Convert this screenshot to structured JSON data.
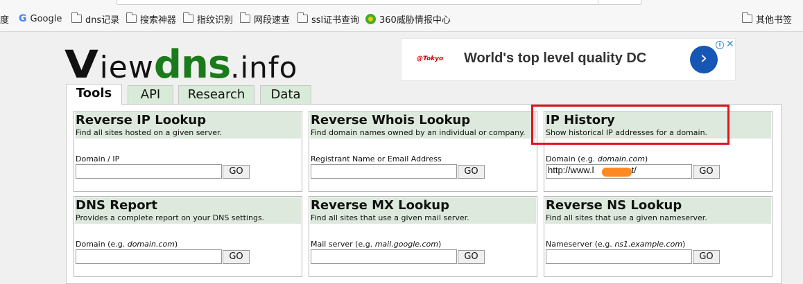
{
  "bookmarks": [
    {
      "label": "度",
      "icon": "none"
    },
    {
      "label": "Google",
      "icon": "google-icon"
    },
    {
      "label": "dns记录",
      "icon": "folder-icon"
    },
    {
      "label": "搜索神器",
      "icon": "folder-icon"
    },
    {
      "label": "指纹识别",
      "icon": "folder-icon"
    },
    {
      "label": "网段速查",
      "icon": "folder-icon"
    },
    {
      "label": "ssl证书查询",
      "icon": "folder-icon"
    },
    {
      "label": "360威胁情报中心",
      "icon": "360-icon"
    },
    {
      "label": "其他书签",
      "icon": "folder-icon"
    }
  ],
  "logo": {
    "v": "V",
    "iew": "iew",
    "dns": "dns",
    "info": ".info"
  },
  "ad": {
    "brand": "@Tokyo",
    "text": "World's top level quality DC",
    "arrow": "›",
    "info": "i",
    "close": "✕"
  },
  "tabs": [
    "Tools",
    "API",
    "Research",
    "Data"
  ],
  "tools": [
    {
      "title": "Reverse IP Lookup",
      "desc": "Find all sites hosted on a given server.",
      "label": "Domain / IP",
      "label_example": "",
      "label_suffix": "",
      "value": "",
      "go": "GO"
    },
    {
      "title": "Reverse Whois Lookup",
      "desc": "Find domain names owned by an individual or company.",
      "label": "Registrant Name or Email Address",
      "label_example": "",
      "label_suffix": "",
      "value": "",
      "go": "GO"
    },
    {
      "title": "IP History",
      "desc": "Show historical IP addresses for a domain.",
      "label": "Domain (e.g. ",
      "label_example": "domain.com",
      "label_suffix": ")",
      "value": "http://www.l        o.net/",
      "go": "GO"
    },
    {
      "title": "DNS Report",
      "desc": "Provides a complete report on your DNS settings.",
      "label": "Domain (e.g. ",
      "label_example": "domain.com",
      "label_suffix": ")",
      "value": "",
      "go": "GO"
    },
    {
      "title": "Reverse MX Lookup",
      "desc": "Find all sites that use a given mail server.",
      "label": "Mail server (e.g. ",
      "label_example": "mail.google.com",
      "label_suffix": ")",
      "value": "",
      "go": "GO"
    },
    {
      "title": "Reverse NS Lookup",
      "desc": "Find all sites that use a given nameserver.",
      "label": "Nameserver (e.g. ",
      "label_example": "ns1.example.com",
      "label_suffix": ")",
      "value": "",
      "go": "GO"
    }
  ],
  "colors": {
    "dns_green": "#1b7a1b",
    "box_header": "#dde9dd",
    "tab_bg": "#d8ead8",
    "highlight": "#e0141e",
    "redaction": "#ff8a24"
  }
}
